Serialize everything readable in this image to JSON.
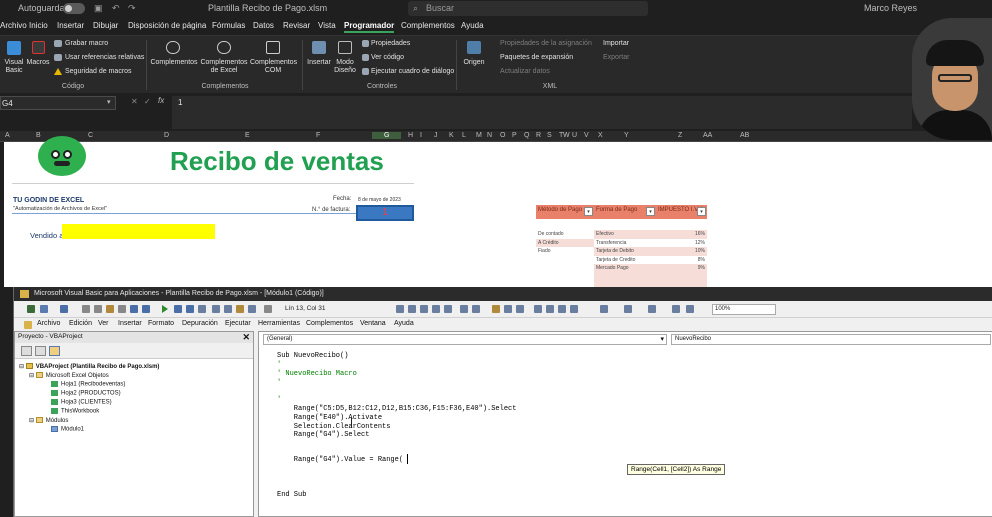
{
  "excel": {
    "titlebar": {
      "autosave_label": "Autoguardado",
      "filename": "Plantilla Recibo de Pago.xlsm",
      "search_placeholder": "Buscar",
      "user_name": "Marco Reyes"
    },
    "menu": [
      "Archivo",
      "Inicio",
      "Insertar",
      "Dibujar",
      "Disposición de página",
      "Fórmulas",
      "Datos",
      "Revisar",
      "Vista",
      "Programador",
      "Complementos",
      "Ayuda"
    ],
    "menu_active": "Programador",
    "ribbon": {
      "codigo": {
        "visual_basic": "Visual Basic",
        "macros": "Macros",
        "grabar": "Grabar macro",
        "referencias": "Usar referencias relativas",
        "seguridad": "Seguridad de macros",
        "group": "Código"
      },
      "complementos": {
        "complementos": "Complementos",
        "excel": "Complementos de Excel",
        "com": "Complementos COM",
        "group": "Complementos"
      },
      "controles": {
        "insertar": "Insertar",
        "modo": "Modo Diseño",
        "propiedades": "Propiedades",
        "ver_codigo": "Ver código",
        "ejecutar": "Ejecutar cuadro de diálogo",
        "group": "Controles"
      },
      "xml": {
        "origen": "Origen",
        "prop_asignacion": "Propiedades de la asignación",
        "paquetes": "Paquetes de expansión",
        "actualizar": "Actualizar datos",
        "importar": "Importar",
        "exportar": "Exportar",
        "group": "XML"
      }
    },
    "formula_bar": {
      "name_box": "G4",
      "fx": "fx",
      "value": "1"
    },
    "columns": [
      "A",
      "B",
      "C",
      "D",
      "E",
      "F",
      "G",
      "H",
      "I",
      "J",
      "K",
      "L",
      "M",
      "N",
      "O",
      "P",
      "Q",
      "R",
      "S",
      "T",
      "U",
      "V",
      "W",
      "X",
      "Y",
      "Z",
      "AA",
      "AB"
    ],
    "selected_column": "G"
  },
  "sheet": {
    "title": "Recibo de ventas",
    "company": "TU GODIN DE EXCEL",
    "slogan": "\"Automatización de Archivos de Excel\"",
    "fecha_label": "Fecha:",
    "fecha_value": "8 de mayo de 2023",
    "factura_label": "N.° de factura:",
    "factura_value": "1",
    "vendido_label": "Vendido a:",
    "metodo_header": "Método de Pago",
    "metodo_items": [
      "De contado",
      "A Crédito",
      "Fiado"
    ],
    "forma_header": "Forma de Pago",
    "impuesto_header": "IMPUESTO I.V.A",
    "forma_items": [
      {
        "name": "Efectivo",
        "tax": "16%"
      },
      {
        "name": "Transferencia",
        "tax": "12%"
      },
      {
        "name": "Tarjeta de Debito",
        "tax": "10%"
      },
      {
        "name": "Tarjeta de Credito",
        "tax": "8%"
      },
      {
        "name": "Mercado Pago",
        "tax": "9%"
      }
    ],
    "dropdown_glyph": "▾"
  },
  "vba": {
    "title": "Microsoft Visual Basic para Aplicaciones - Plantilla Recibo de Pago.xlsm - [Módulo1 (Código)]",
    "position": "Lín 13, Col 31",
    "zoom": "100%",
    "menu": [
      "Archivo",
      "Edición",
      "Ver",
      "Insertar",
      "Formato",
      "Depuración",
      "Ejecutar",
      "Herramientas",
      "Complementos",
      "Ventana",
      "Ayuda"
    ],
    "project_title": "Proyecto - VBAProject",
    "close_glyph": "✕",
    "tree": {
      "root": "VBAProject (Plantilla Recibo de Pago.xlsm)",
      "folder_objects": "Microsoft Excel Objetos",
      "objects": [
        "Hoja1 (Recibodeventas)",
        "Hoja2 (PRODUCTOS)",
        "Hoja3 (CLIENTES)",
        "ThisWorkbook"
      ],
      "folder_modules": "Módulos",
      "modules": [
        "Módulo1"
      ]
    },
    "combo_left": "(General)",
    "combo_right": "NuevoRecibo",
    "code": [
      "Sub NuevoRecibo()",
      "'",
      "' NuevoRecibo Macro",
      "'",
      "",
      "'",
      "    Range(\"C5:D5,B12:C12,D12,B15:C36,F15:F36,E40\").Select",
      "    Range(\"E40\").Activate",
      "    Selection.ClearContents",
      "    Range(\"G4\").Select",
      "",
      "",
      "    Range(\"G4\").Value = Range(",
      "",
      "",
      "",
      "End Sub"
    ],
    "tooltip": "Range(Cell1, [Cell2]) As Range"
  },
  "colors": {
    "accent_green": "#20a050",
    "excel_dark": "#1f1f1f",
    "invoice_blue": "#3a78c2",
    "highlight_yellow": "#ffff00",
    "table_salmon": "#e8806a"
  }
}
